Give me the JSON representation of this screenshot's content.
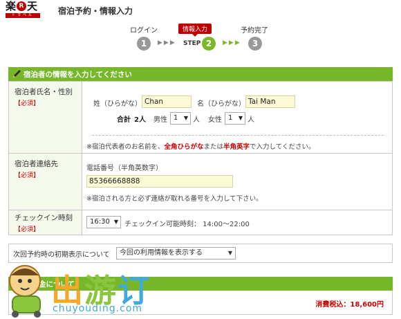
{
  "header": {
    "logo_kanji_1": "楽",
    "logo_r": "R",
    "logo_kanji_2": "天",
    "logo_sub": "トラベル",
    "title": "宿泊予約・情報入力"
  },
  "steps": {
    "login": "ログイン",
    "current": "情報入力",
    "done": "予約完了",
    "step_word": "STEP",
    "n1": "1",
    "n2": "2",
    "n3": "3",
    "arrows": "▶▶▶"
  },
  "section": {
    "title": "宿泊者の情報を入力してください"
  },
  "guest": {
    "label": "宿泊者氏名・性別",
    "required": "【必須】",
    "sei_label": "姓（ひらがな）",
    "sei_value": "Chan",
    "mei_label": "名（ひらがな）",
    "mei_value": "Tai Man",
    "total_label": "合計",
    "total_value": "2人",
    "male_label": "男性",
    "male_value": "1",
    "female_label": "女性",
    "female_value": "1",
    "unit": "人",
    "note_pre": "※宿泊代表者のお名前を、",
    "note_red1": "全角ひらがな",
    "note_mid": "または",
    "note_red2": "半角英字",
    "note_post": "で入力してください。"
  },
  "contact": {
    "label": "宿泊者連絡先",
    "required": "【必須】",
    "phone_label": "電話番号（半角英数字）",
    "phone_value": "85366668888",
    "note": "※宿泊される方と必ず連絡が取れる番号を入力して下さい。"
  },
  "checkin": {
    "label": "チェックイン時刻",
    "required": "【必須】",
    "value": "16:30",
    "range_text": "チェックイン可能時刻： 14:00～22:00"
  },
  "next_display": {
    "label": "次回予約時の初期表示について",
    "value": "今回の利用情報を表示する"
  },
  "fee": {
    "title_partial": "金について",
    "label_partial": "料",
    "price": "消費税込：18,600円"
  },
  "watermark": {
    "t1": "出",
    "t2": "游",
    "t3": "订",
    "url": "chuyouding.com"
  },
  "colors": {
    "brand_red": "#bf0000",
    "green": "#76b82a",
    "input_bg": "#fdfbd7"
  }
}
